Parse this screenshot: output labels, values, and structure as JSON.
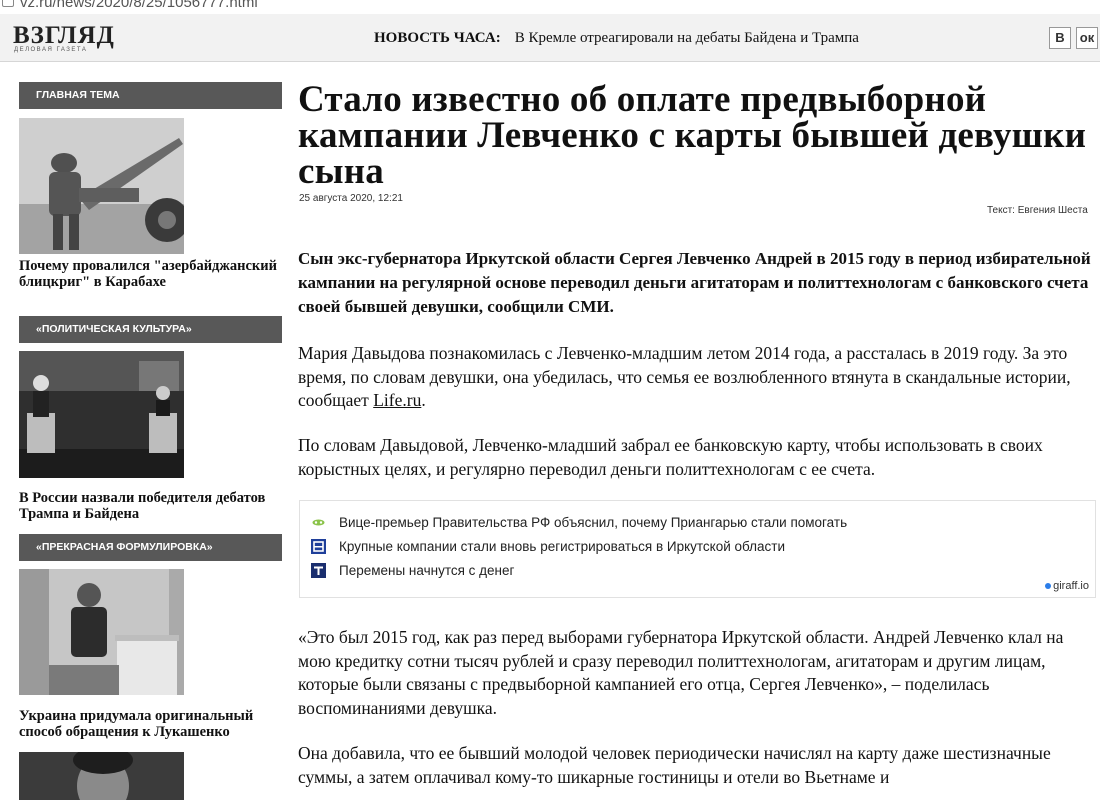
{
  "browser": {
    "url": "vz.ru/news/2020/8/25/1056777.html"
  },
  "site": {
    "logo_main": "ВЗГЛЯД",
    "logo_sub": "ДЕЛОВАЯ ГАЗЕТА",
    "news_hour_label": "НОВОСТЬ ЧАСА:",
    "news_hour_text": "В Кремле отреагировали на дебаты Байдена и Трампа",
    "social": [
      "В",
      "ок"
    ]
  },
  "sidebar": [
    {
      "heading": "ГЛАВНАЯ ТЕМА",
      "title": "Почему провалился \"азербайджанский блицкриг\" в Карабахе"
    },
    {
      "heading": "«ПОЛИТИЧЕСКАЯ КУЛЬТУРА»",
      "title": "В России назвали победителя дебатов Трампа и Байдена"
    },
    {
      "heading": "«ПРЕКРАСНАЯ ФОРМУЛИРОВКА»",
      "title": "Украина придумала оригинальный способ обращения к Лукашенко"
    }
  ],
  "article": {
    "headline": "Стало известно об оплате предвыборной кампании Левченко с карты бывшей девушки сына",
    "date": "25 августа 2020, 12:21",
    "author": "Текст: Евгения Шеста",
    "lead": "Сын экс-губернатора Иркутской области Сергея Левченко Андрей в 2015 году в период избирательной кампании на регулярной основе переводил деньги агитаторам и политтехнологам с банковского счета своей бывшей девушки, сообщили СМИ.",
    "p1_text": "Мария Давыдова познакомилась с Левченко-младшим летом 2014 года, а рассталась в 2019 году. За это время, по словам девушки, она убедилась, что семья ее возлюбленного втянута в скандальные истории, сообщает ",
    "p1_link": "Life.ru",
    "p1_end": ".",
    "p2": "По словам Давыдовой, Левченко-младший забрал ее банковскую карту, чтобы использовать в своих корыстных целях, и регулярно переводил деньги политтехнологам с ее счета.",
    "p3": "«Это был 2015 год, как раз перед выборами губернатора Иркутской области. Андрей Левченко клал на мою кредитку сотни тысяч рублей и сразу переводил политтехнологам, агитаторам и другим лицам, которые были связаны с предвыборной кампанией его отца, Сергея Левченко», – поделилась воспоминаниями девушка.",
    "p4": "Она добавила, что ее бывший молодой человек периодически начислял на карту даже шестизначные суммы, а затем оплачивал кому-то шикарные гостиницы и отели во Вьетнаме и"
  },
  "widget": {
    "items": [
      {
        "icon": "green-logo-icon",
        "text": "Вице-премьер Правительства РФ объяснил, почему Приангарью стали помогать"
      },
      {
        "icon": "blue-b-icon",
        "text": "Крупные компании стали вновь регистрироваться в Иркутской области"
      },
      {
        "icon": "blue-t-icon",
        "text": "Перемены начнутся с денег"
      }
    ],
    "brand": "giraff.io"
  }
}
